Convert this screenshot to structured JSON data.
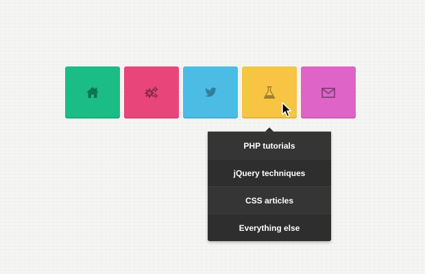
{
  "nav": {
    "tiles": [
      {
        "icon": "home-icon",
        "color": "#1bbc86"
      },
      {
        "icon": "gears-icon",
        "color": "#e8467b"
      },
      {
        "icon": "twitter-bird-icon",
        "color": "#4cbce4"
      },
      {
        "icon": "flask-icon",
        "color": "#f7c444"
      },
      {
        "icon": "envelope-icon",
        "color": "#de64c7"
      }
    ]
  },
  "dropdown": {
    "items": [
      {
        "label": "PHP tutorials"
      },
      {
        "label": "jQuery techniques"
      },
      {
        "label": "CSS articles"
      },
      {
        "label": "Everything else"
      }
    ]
  }
}
